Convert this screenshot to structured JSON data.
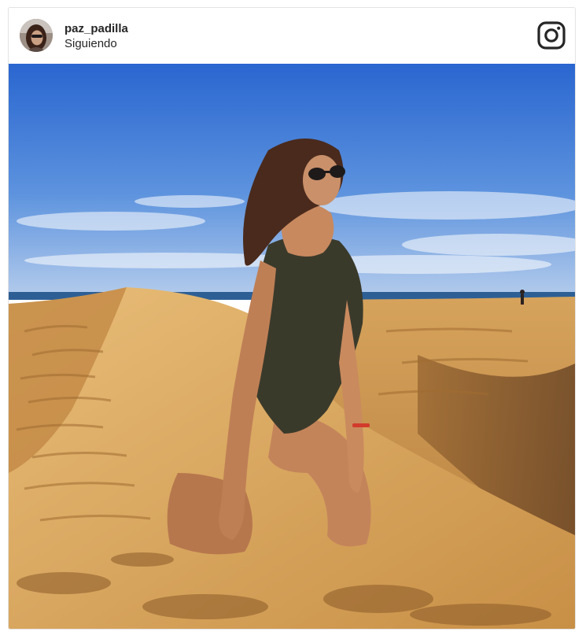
{
  "post": {
    "username": "paz_padilla",
    "follow_status": "Siguiendo",
    "avatar_icon": "user-avatar",
    "logo_icon": "instagram-icon",
    "photo_alt": "paz_padilla"
  },
  "colors": {
    "sky_top": "#2f6fd6",
    "sky_bottom": "#a9c6ea",
    "sand_light": "#e0b06a",
    "sand_mid": "#c98f45",
    "sand_shadow": "#8a5a2a",
    "swimsuit": "#3b3a2c",
    "skin": "#c8895f",
    "hair": "#4a2a1c"
  }
}
